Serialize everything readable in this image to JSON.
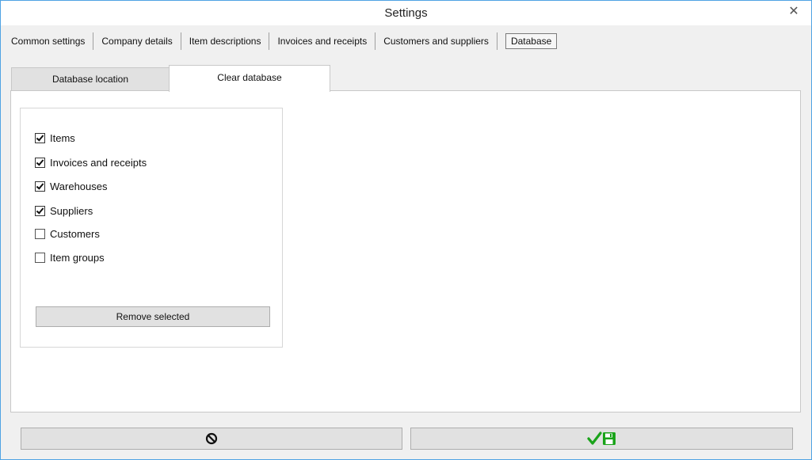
{
  "window": {
    "title": "Settings",
    "close_symbol": "✕"
  },
  "top_tabs": [
    {
      "label": "Common settings"
    },
    {
      "label": "Company details"
    },
    {
      "label": "Item descriptions"
    },
    {
      "label": "Invoices and receipts"
    },
    {
      "label": "Customers and suppliers"
    },
    {
      "label": "Database",
      "active": true
    }
  ],
  "sub_tabs": [
    {
      "label": "Database location"
    },
    {
      "label": "Clear database",
      "active": true
    }
  ],
  "checkboxes": [
    {
      "label": "Items",
      "checked": true
    },
    {
      "label": "Invoices and receipts",
      "checked": true
    },
    {
      "label": "Warehouses",
      "checked": true
    },
    {
      "label": "Suppliers",
      "checked": true
    },
    {
      "label": "Customers",
      "checked": false
    },
    {
      "label": "Item groups",
      "checked": false
    }
  ],
  "remove_button": {
    "label": "Remove selected"
  },
  "bottom_buttons": {
    "cancel_icon": "cancel-circle-icon",
    "save_icon": "check-save-icon",
    "save_color": "#1aa31a"
  },
  "colors": {
    "window_border": "#4fa3e3",
    "background": "#f0f0f0",
    "check_color": "#1aa31a"
  }
}
